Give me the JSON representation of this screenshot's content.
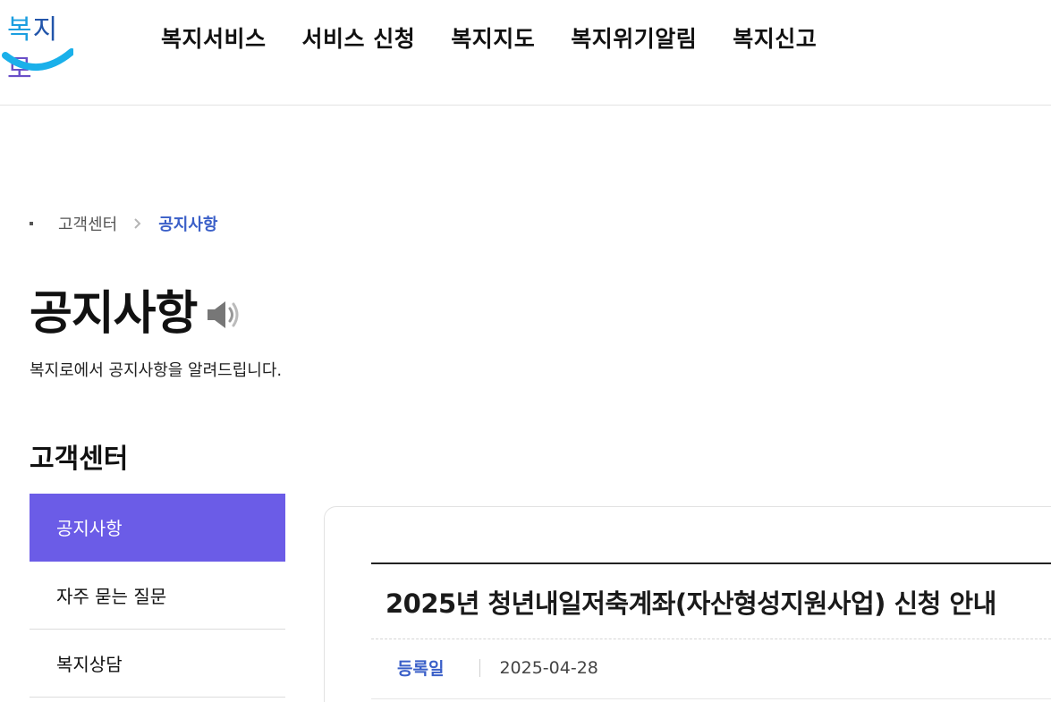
{
  "logo": {
    "part1": "복",
    "part2": "지",
    "part3": "로"
  },
  "gnb": [
    "복지서비스",
    "서비스 신청",
    "복지지도",
    "복지위기알림",
    "복지신고"
  ],
  "breadcrumb": {
    "home": "고객센터",
    "current": "공지사항"
  },
  "page": {
    "title": "공지사항",
    "description": "복지로에서 공지사항을 알려드립니다."
  },
  "sidebar": {
    "title": "고객센터",
    "items": [
      {
        "label": "공지사항",
        "active": true
      },
      {
        "label": "자주 묻는 질문",
        "active": false
      },
      {
        "label": "복지상담",
        "active": false
      }
    ]
  },
  "article": {
    "title": "2025년 청년내일저축계좌(자산형성지원사업) 신청 안내",
    "date_label": "등록일",
    "date": "2025-04-28"
  },
  "icons": {
    "speaker": "speaker-icon",
    "chevron": "chevron-right-icon"
  },
  "colors": {
    "accent": "#6b5ce7",
    "link": "#3a5fc8",
    "logo_blue": "#1ab0ea"
  }
}
